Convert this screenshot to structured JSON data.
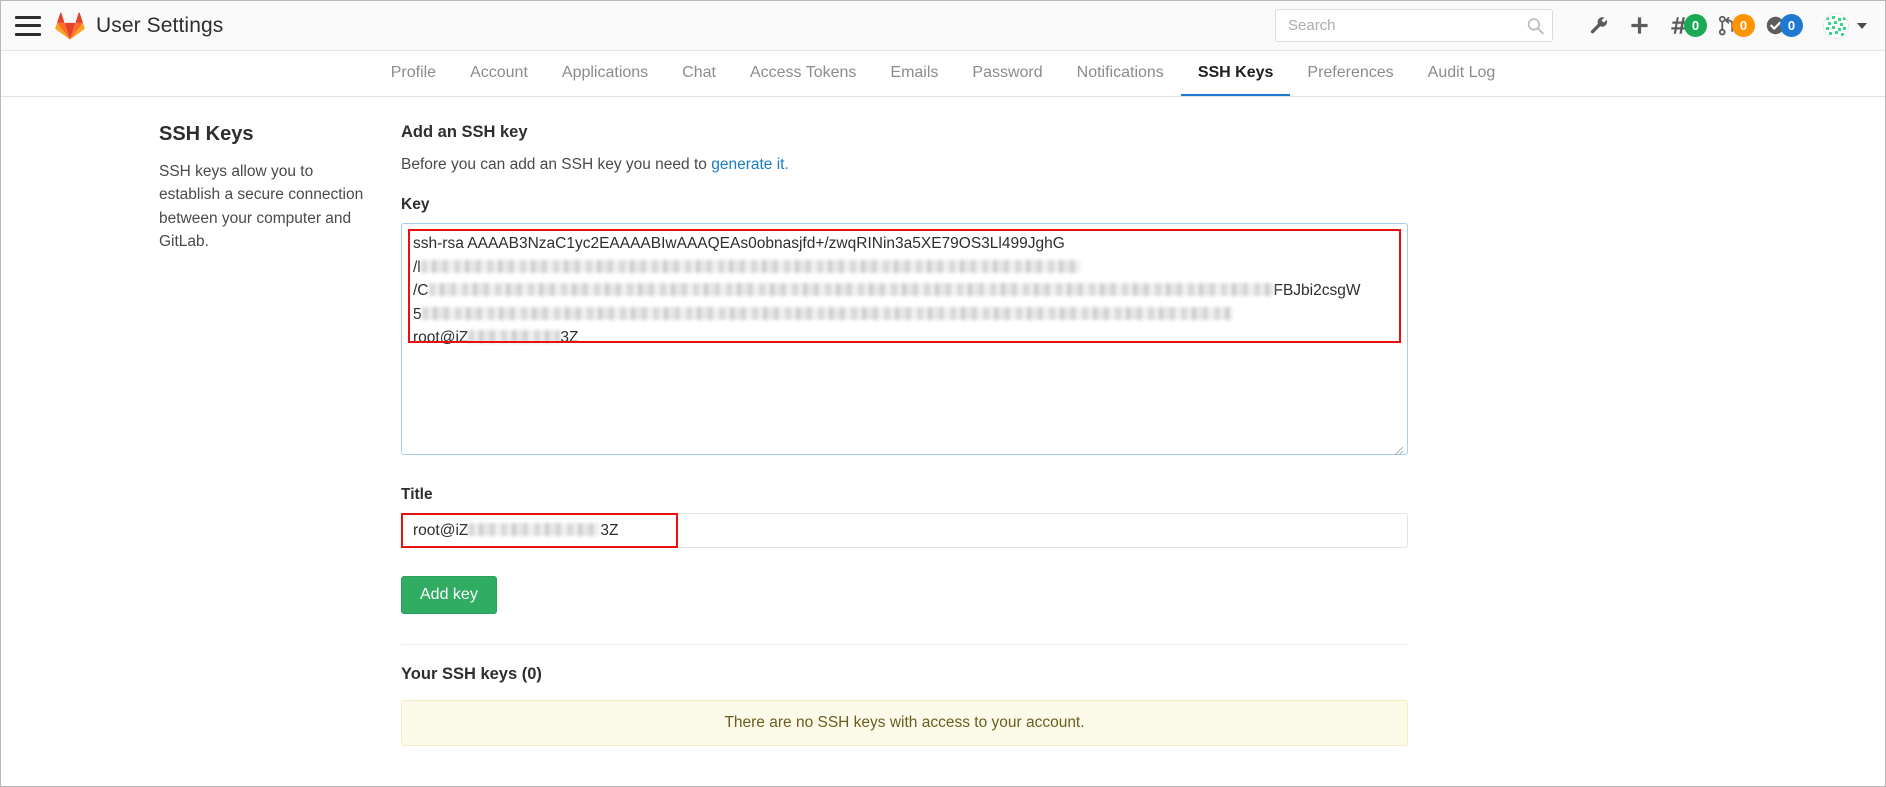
{
  "navbar": {
    "title": "User Settings",
    "menu_icon": "hamburger-icon",
    "logo_icon": "gitlab-tanuki-logo",
    "search": {
      "value": "",
      "placeholder": "Search",
      "icon": "search-icon"
    },
    "actions": [
      {
        "icon": "wrench-icon",
        "name": "admin-area"
      },
      {
        "icon": "plus-icon",
        "name": "new-item"
      }
    ],
    "counters": [
      {
        "icon": "issues-hash-icon",
        "name": "issues",
        "count": "0",
        "color": "#1aaa55"
      },
      {
        "icon": "merge-request-icon",
        "name": "merge-requests",
        "count": "0",
        "color": "#fc9403"
      },
      {
        "icon": "todos-check-icon",
        "name": "todos",
        "count": "0",
        "color": "#1f78d1"
      }
    ],
    "avatar": {
      "name": "user-avatar",
      "icon": "identicon-avatar"
    },
    "caret_icon": "chevron-down-icon"
  },
  "subnav": {
    "tabs": [
      {
        "label": "Profile",
        "active": false
      },
      {
        "label": "Account",
        "active": false
      },
      {
        "label": "Applications",
        "active": false
      },
      {
        "label": "Chat",
        "active": false
      },
      {
        "label": "Access Tokens",
        "active": false
      },
      {
        "label": "Emails",
        "active": false
      },
      {
        "label": "Password",
        "active": false
      },
      {
        "label": "Notifications",
        "active": false
      },
      {
        "label": "SSH Keys",
        "active": true
      },
      {
        "label": "Preferences",
        "active": false
      },
      {
        "label": "Audit Log",
        "active": false
      }
    ]
  },
  "sidebar": {
    "title": "SSH Keys",
    "description": "SSH keys allow you to establish a secure connection between your computer and GitLab."
  },
  "form": {
    "heading": "Add an SSH key",
    "hint_prefix": "Before you can add an SSH key you need to ",
    "hint_link": "generate it.",
    "key_label": "Key",
    "key_placeholder": "",
    "key_lines": [
      {
        "visible_start": "ssh-rsa AAAAB3NzaC1yc2EAAAABIwAAAQEAs0obnasjfd+/zwqRINin3a5XE79OS3Ll499JghG",
        "redacted": false,
        "redact_width": 0,
        "visible_end": ""
      },
      {
        "visible_start": "/l",
        "redacted": true,
        "redact_width": 660,
        "visible_end": ""
      },
      {
        "visible_start": "/C",
        "redacted": true,
        "redact_width": 845,
        "visible_end": "FBJbi2csgW"
      },
      {
        "visible_start": "5",
        "redacted": true,
        "redact_width": 810,
        "visible_end": ""
      },
      {
        "visible_start": "root@iZ",
        "redacted": true,
        "redact_width": 92,
        "visible_end": "3Z"
      }
    ],
    "title_label": "Title",
    "title_value_start": "root@iZ",
    "title_value_redact_width": 132,
    "title_value_end": "3Z",
    "submit_label": "Add key"
  },
  "keys_section": {
    "heading": "Your SSH keys (0)",
    "empty_message": "There are no SSH keys with access to your account."
  },
  "colors": {
    "brand_orange": "#e24329",
    "link_blue": "#1b7bc4",
    "button_green": "#31ad63",
    "annotation_red": "#e8110f",
    "alert_bg": "#fcfae8"
  }
}
